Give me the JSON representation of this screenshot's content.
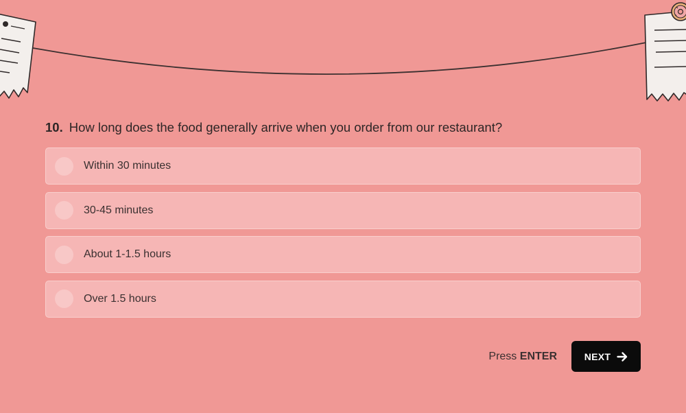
{
  "colors": {
    "background": "#f09895",
    "option_background": "#f6b6b5",
    "button_background": "#0b0b0b"
  },
  "question": {
    "number": "10.",
    "text": "How long does the food generally arrive when you order from our restaurant?"
  },
  "options": [
    {
      "label": "Within 30 minutes"
    },
    {
      "label": "30-45 minutes"
    },
    {
      "label": "About 1-1.5 hours"
    },
    {
      "label": "Over 1.5 hours"
    }
  ],
  "footer": {
    "press_prefix": "Press",
    "press_key": "ENTER",
    "next_label": "NEXT",
    "next_icon": "arrow-right-icon"
  },
  "decorations": {
    "left": "receipt-note-icon",
    "right": "receipt-note-with-donut-icon"
  }
}
